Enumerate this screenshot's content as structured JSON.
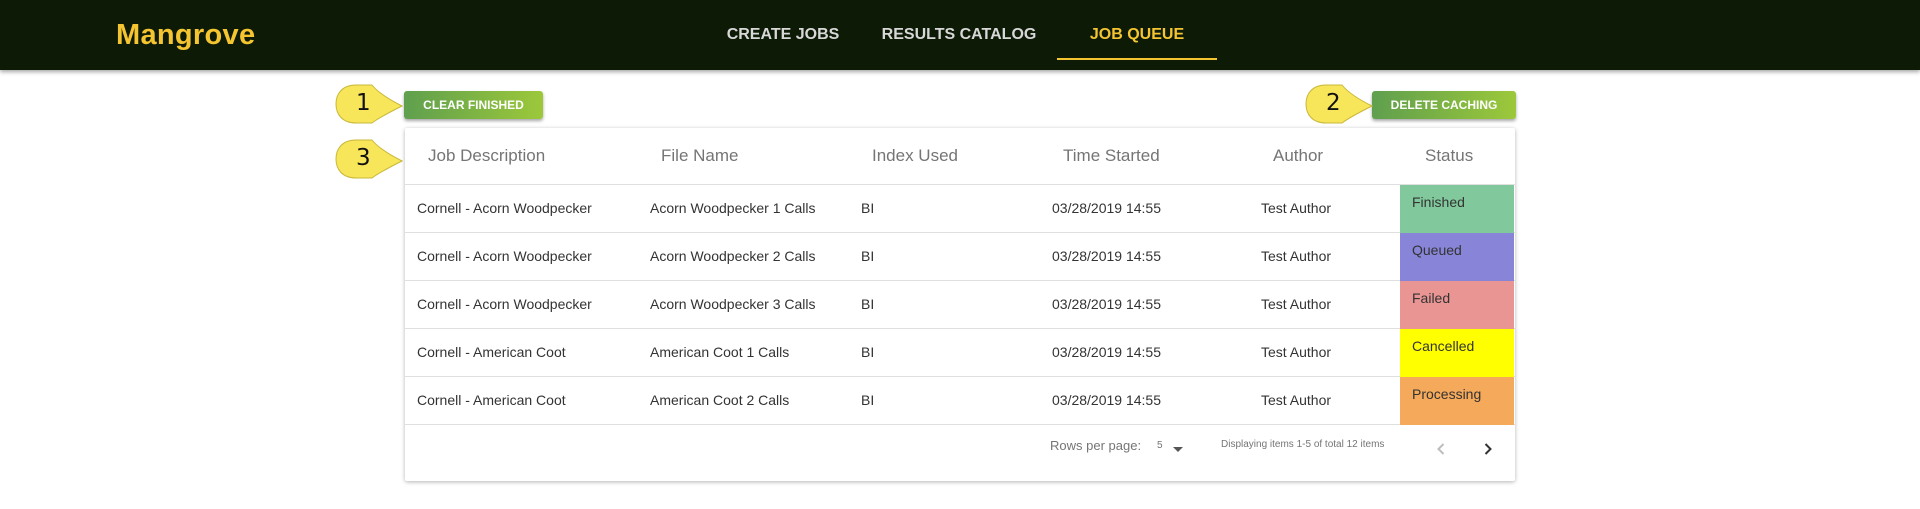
{
  "app": {
    "brand": "Mangrove",
    "colors": {
      "navbar_bg": "#0c1a06",
      "accent": "#f5c531",
      "button_gradient_start": "#5f9f4e",
      "button_gradient_end": "#9cc83a",
      "callout_fill": "#f7e55a"
    }
  },
  "nav": {
    "tabs": [
      {
        "label": "CREATE JOBS",
        "active": false
      },
      {
        "label": "RESULTS CATALOG",
        "active": false
      },
      {
        "label": "JOB QUEUE",
        "active": true
      }
    ]
  },
  "toolbar": {
    "clear_label": "CLEAR FINISHED",
    "delete_label": "DELETE CACHING"
  },
  "callouts": [
    "1",
    "2",
    "3"
  ],
  "table": {
    "columns": [
      "Job Description",
      "File Name",
      "Index Used",
      "Time Started",
      "Author",
      "Status"
    ],
    "rows": [
      {
        "description": "Cornell - Acorn Woodpecker",
        "file": "Acorn Woodpecker 1 Calls",
        "index": "BI",
        "time": "03/28/2019 14:55",
        "author": "Test Author",
        "status": "Finished",
        "status_color": "#81c99c"
      },
      {
        "description": "Cornell - Acorn Woodpecker",
        "file": "Acorn Woodpecker 2 Calls",
        "index": "BI",
        "time": "03/28/2019 14:55",
        "author": "Test Author",
        "status": "Queued",
        "status_color": "#8885d8"
      },
      {
        "description": "Cornell - Acorn Woodpecker",
        "file": "Acorn Woodpecker 3 Calls",
        "index": "BI",
        "time": "03/28/2019 14:55",
        "author": "Test Author",
        "status": "Failed",
        "status_color": "#e99593"
      },
      {
        "description": "Cornell - American Coot",
        "file": "American Coot 1 Calls",
        "index": "BI",
        "time": "03/28/2019 14:55",
        "author": "Test Author",
        "status": "Cancelled",
        "status_color": "#ffff00"
      },
      {
        "description": "Cornell - American Coot",
        "file": "American Coot 2 Calls",
        "index": "BI",
        "time": "03/28/2019 14:55",
        "author": "Test Author",
        "status": "Processing",
        "status_color": "#f5a95a"
      }
    ]
  },
  "footer": {
    "rows_per_page_label": "Rows per page:",
    "rows_per_page_value": "5",
    "range_label": "Displaying items 1-5 of total 12 items",
    "prev_icon": "chevron-left-icon",
    "next_icon": "chevron-right-icon"
  }
}
